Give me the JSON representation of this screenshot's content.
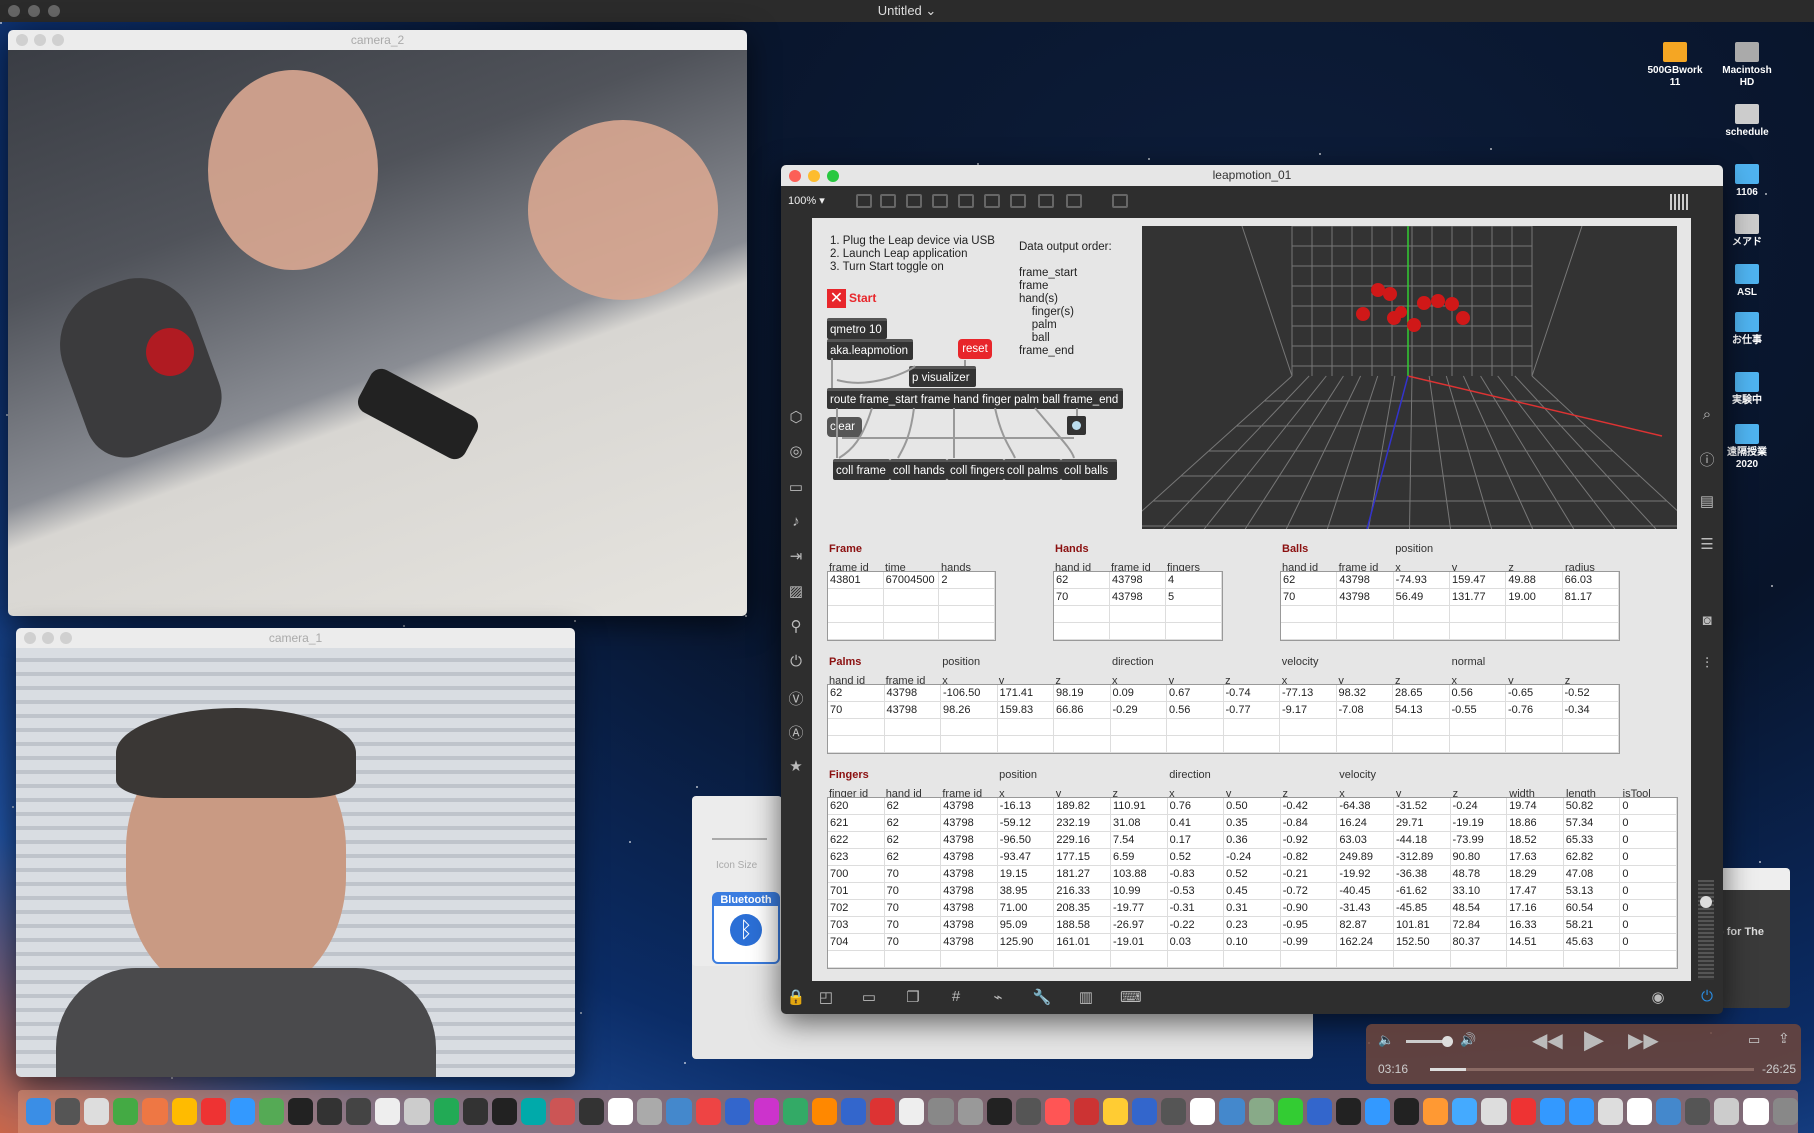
{
  "menubar": {
    "title": "Untitled ⌄"
  },
  "desktop": {
    "icons": [
      {
        "label": "500GBwork\n11",
        "color": "#f5a623"
      },
      {
        "label": "Macintosh\nHD",
        "color": "#aaa"
      },
      {
        "label": "schedule",
        "color": "#ccc"
      },
      {
        "label": "1106",
        "color": "#4fb3f0"
      },
      {
        "label": "メアド",
        "color": "#ccc"
      },
      {
        "label": "ASL",
        "color": "#4fb3f0"
      },
      {
        "label": "お仕事",
        "color": "#4fb3f0"
      },
      {
        "label": "実験中",
        "color": "#4fb3f0"
      },
      {
        "label": "遠隔授業\n2020",
        "color": "#4fb3f0"
      }
    ]
  },
  "camera2": {
    "title": "camera_2"
  },
  "camera1": {
    "title": "camera_1"
  },
  "iconsize": {
    "label": "Icon Size",
    "bluetooth": "Bluetooth"
  },
  "bgwindow": {
    "text": ") for The"
  },
  "leap": {
    "title": "leapmotion_01",
    "zoom": "100% ▾",
    "instructions": "1. Plug the Leap device via USB\n2. Launch Leap application\n3. Turn Start toggle on",
    "order": "Data output order:\n\nframe_start\nframe\nhand(s)\n    finger(s)\n    palm\n    ball\nframe_end",
    "start": "Start",
    "objects": {
      "qmetro": "qmetro 10",
      "aka": "aka.leapmotion",
      "reset": "reset",
      "pvis": "p visualizer",
      "route": "route frame_start frame hand finger palm ball frame_end",
      "clear": "clear",
      "coll_frame": "coll frame",
      "coll_hands": "coll hands",
      "coll_fingers": "coll fingers",
      "coll_palms": "coll palms",
      "coll_balls": "coll balls"
    }
  },
  "tables": {
    "frame": {
      "title": "Frame",
      "groups": [],
      "headers": [
        "frame id",
        "time",
        "hands"
      ],
      "rows": [
        [
          "43801",
          "67004500",
          "2"
        ]
      ],
      "blank": 3
    },
    "hands": {
      "title": "Hands",
      "groups": [],
      "headers": [
        "hand id",
        "frame id",
        "fingers"
      ],
      "rows": [
        [
          "62",
          "43798",
          "4"
        ],
        [
          "70",
          "43798",
          "5"
        ]
      ],
      "blank": 2
    },
    "balls": {
      "title": "Balls",
      "groups": [
        {
          "label": "position",
          "col": 2
        }
      ],
      "headers": [
        "hand id",
        "frame id",
        "x",
        "y",
        "z",
        "radius"
      ],
      "rows": [
        [
          "62",
          "43798",
          "-74.93",
          "159.47",
          "49.88",
          "66.03"
        ],
        [
          "70",
          "43798",
          "56.49",
          "131.77",
          "19.00",
          "81.17"
        ]
      ],
      "blank": 2
    },
    "palms": {
      "title": "Palms",
      "groups": [
        {
          "label": "position",
          "col": 2
        },
        {
          "label": "direction",
          "col": 5
        },
        {
          "label": "velocity",
          "col": 8
        },
        {
          "label": "normal",
          "col": 11
        }
      ],
      "headers": [
        "hand id",
        "frame id",
        "x",
        "y",
        "z",
        "x",
        "y",
        "z",
        "x",
        "y",
        "z",
        "x",
        "y",
        "z"
      ],
      "rows": [
        [
          "62",
          "43798",
          "-106.50",
          "171.41",
          "98.19",
          "0.09",
          "0.67",
          "-0.74",
          "-77.13",
          "98.32",
          "28.65",
          "0.56",
          "-0.65",
          "-0.52"
        ],
        [
          "70",
          "43798",
          "98.26",
          "159.83",
          "66.86",
          "-0.29",
          "0.56",
          "-0.77",
          "-9.17",
          "-7.08",
          "54.13",
          "-0.55",
          "-0.76",
          "-0.34"
        ]
      ],
      "blank": 2
    },
    "fingers": {
      "title": "Fingers",
      "groups": [
        {
          "label": "position",
          "col": 3
        },
        {
          "label": "direction",
          "col": 6
        },
        {
          "label": "velocity",
          "col": 9
        }
      ],
      "headers": [
        "finger id",
        "hand id",
        "frame id",
        "x",
        "y",
        "z",
        "x",
        "y",
        "z",
        "x",
        "y",
        "z",
        "width",
        "length",
        "isTool"
      ],
      "rows": [
        [
          "620",
          "62",
          "43798",
          "-16.13",
          "189.82",
          "110.91",
          "0.76",
          "0.50",
          "-0.42",
          "-64.38",
          "-31.52",
          "-0.24",
          "19.74",
          "50.82",
          "0"
        ],
        [
          "621",
          "62",
          "43798",
          "-59.12",
          "232.19",
          "31.08",
          "0.41",
          "0.35",
          "-0.84",
          "16.24",
          "29.71",
          "-19.19",
          "18.86",
          "57.34",
          "0"
        ],
        [
          "622",
          "62",
          "43798",
          "-96.50",
          "229.16",
          "7.54",
          "0.17",
          "0.36",
          "-0.92",
          "63.03",
          "-44.18",
          "-73.99",
          "18.52",
          "65.33",
          "0"
        ],
        [
          "623",
          "62",
          "43798",
          "-93.47",
          "177.15",
          "6.59",
          "0.52",
          "-0.24",
          "-0.82",
          "249.89",
          "-312.89",
          "90.80",
          "17.63",
          "62.82",
          "0"
        ],
        [
          "700",
          "70",
          "43798",
          "19.15",
          "181.27",
          "103.88",
          "-0.83",
          "0.52",
          "-0.21",
          "-19.92",
          "-36.38",
          "48.78",
          "18.29",
          "47.08",
          "0"
        ],
        [
          "701",
          "70",
          "43798",
          "38.95",
          "216.33",
          "10.99",
          "-0.53",
          "0.45",
          "-0.72",
          "-40.45",
          "-61.62",
          "33.10",
          "17.47",
          "53.13",
          "0"
        ],
        [
          "702",
          "70",
          "43798",
          "71.00",
          "208.35",
          "-19.77",
          "-0.31",
          "0.31",
          "-0.90",
          "-31.43",
          "-45.85",
          "48.54",
          "17.16",
          "60.54",
          "0"
        ],
        [
          "703",
          "70",
          "43798",
          "95.09",
          "188.58",
          "-26.97",
          "-0.22",
          "0.23",
          "-0.95",
          "82.87",
          "101.81",
          "72.84",
          "16.33",
          "58.21",
          "0"
        ],
        [
          "704",
          "70",
          "43798",
          "125.90",
          "161.01",
          "-19.01",
          "0.03",
          "0.10",
          "-0.99",
          "162.24",
          "152.50",
          "80.37",
          "14.51",
          "45.63",
          "0"
        ]
      ],
      "blank": 1
    }
  },
  "player": {
    "elapsed": "03:16",
    "remaining": "-26:25",
    "progress": 0.11,
    "volume": 0.8
  },
  "dock": {
    "colors": [
      "#3a8ee6",
      "#555",
      "#ddd",
      "#4a4",
      "#e74",
      "#fb0",
      "#e33",
      "#39f",
      "#5a5",
      "#222",
      "#333",
      "#444",
      "#eee",
      "#ccc",
      "#2a5",
      "#333",
      "#222",
      "#0aa",
      "#c55",
      "#333",
      "#fff",
      "#aaa",
      "#48c",
      "#e44",
      "#36c",
      "#c3c",
      "#3a6",
      "#f80",
      "#36c",
      "#d33",
      "#eee",
      "#888",
      "#999",
      "#222",
      "#555",
      "#f55",
      "#c33",
      "#fc3",
      "#36c",
      "#555",
      "#fff",
      "#48c",
      "#8a8",
      "#3c3",
      "#36c",
      "#222",
      "#39f",
      "#222",
      "#f93",
      "#4af",
      "#ddd",
      "#e33",
      "#39f",
      "#39f",
      "#ddd",
      "#fff",
      "#48c",
      "#555",
      "#ccc",
      "#fff",
      "#888"
    ]
  }
}
